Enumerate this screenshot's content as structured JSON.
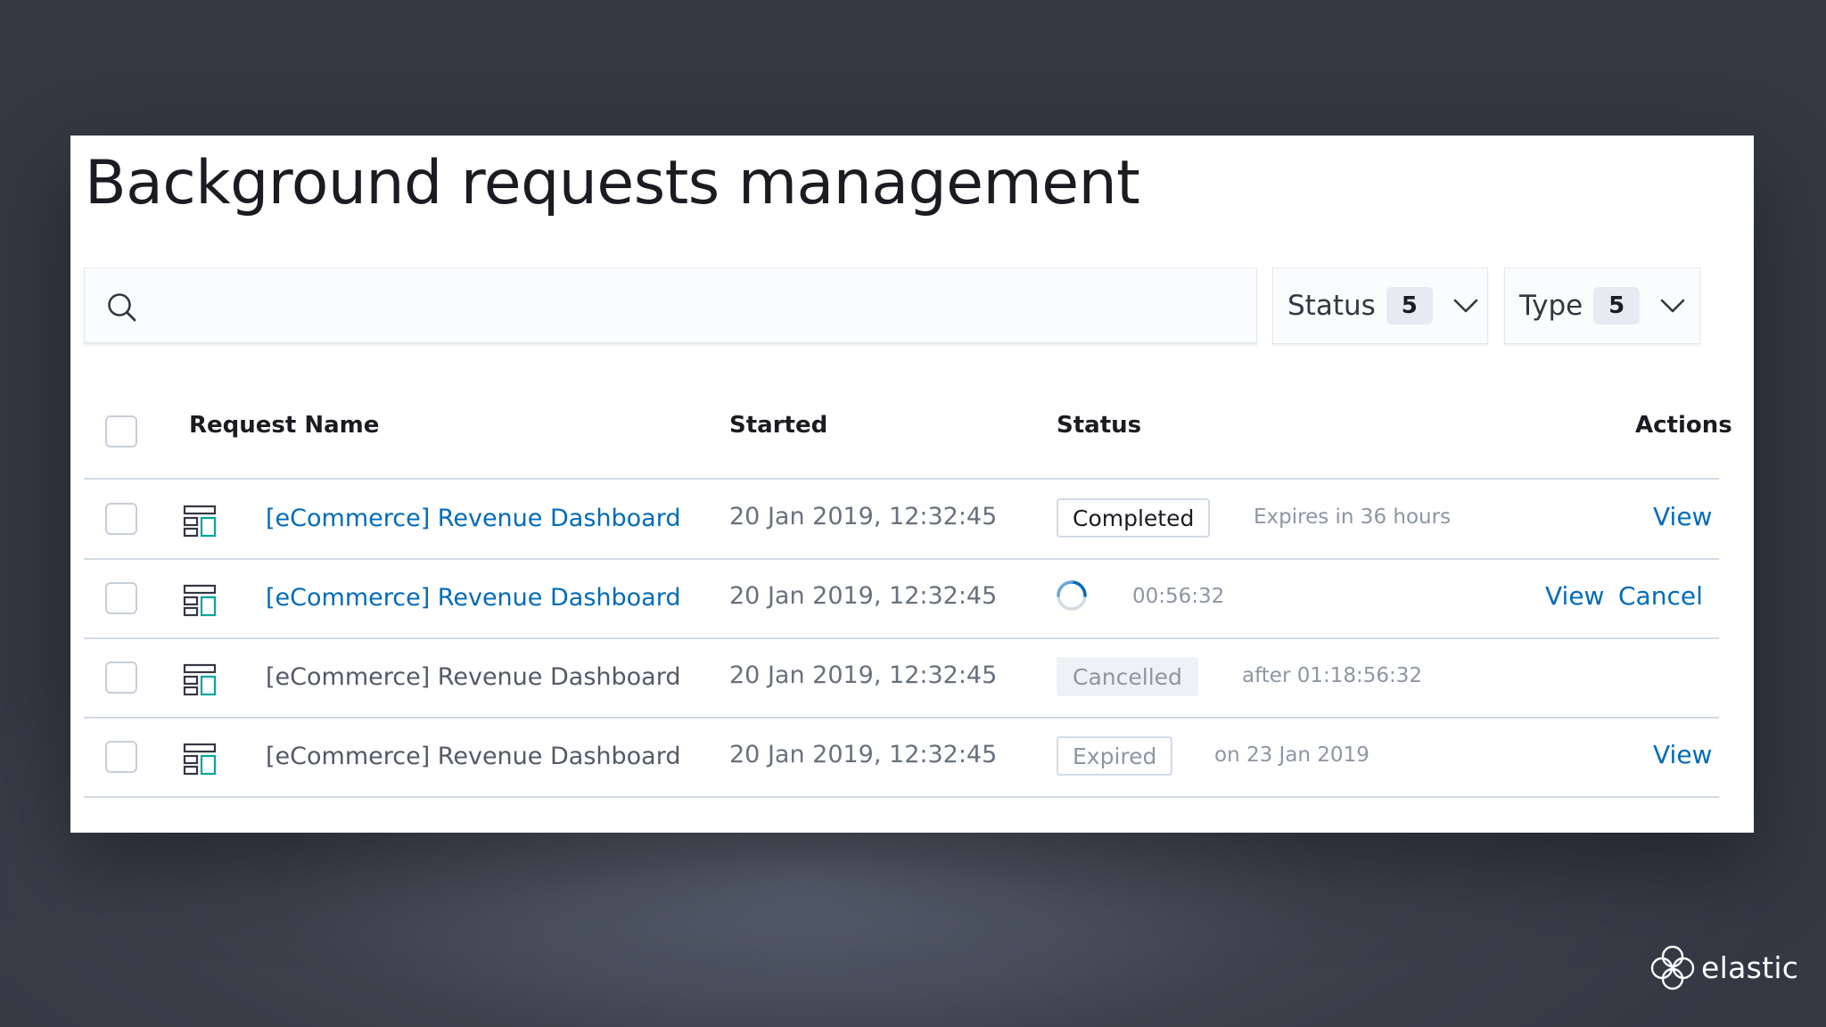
{
  "page": {
    "title": "Background requests management"
  },
  "search": {
    "placeholder": ""
  },
  "filters": [
    {
      "label": "Status",
      "count": "5"
    },
    {
      "label": "Type",
      "count": "5"
    }
  ],
  "table": {
    "columns": [
      "Request Name",
      "Started",
      "Status",
      "Actions"
    ],
    "rows": [
      {
        "name": "[eCommerce] Revenue Dashboard",
        "started": "20 Jan 2019, 12:32:45",
        "status": "Completed",
        "detail": "Expires in 36 hours",
        "actions": [
          "View"
        ]
      },
      {
        "name": "[eCommerce] Revenue Dashboard",
        "started": "20 Jan 2019, 12:32:45",
        "status": "",
        "detail": "00:56:32",
        "actions": [
          "View",
          "Cancel"
        ]
      },
      {
        "name": "[eCommerce] Revenue Dashboard",
        "started": "20 Jan 2019, 12:32:45",
        "status": "Cancelled",
        "detail": "after 01:18:56:32",
        "actions": []
      },
      {
        "name": "[eCommerce] Revenue Dashboard",
        "started": "20 Jan 2019, 12:32:45",
        "status": "Expired",
        "detail": "on 23 Jan 2019",
        "actions": [
          "View"
        ]
      }
    ]
  },
  "brand": {
    "name": "elastic"
  },
  "icons": {
    "search": "search-icon",
    "dashboard": "dashboard-icon",
    "chevron": "chevron-down-icon",
    "spinner": "loading-spinner-icon",
    "logo": "elastic-logo-icon"
  },
  "colors": {
    "link": "#006bb8",
    "text": "#1a1c21",
    "muted": "#8e96a3",
    "border": "#d3dae6",
    "background": "#343843",
    "panel": "#ffffff"
  }
}
